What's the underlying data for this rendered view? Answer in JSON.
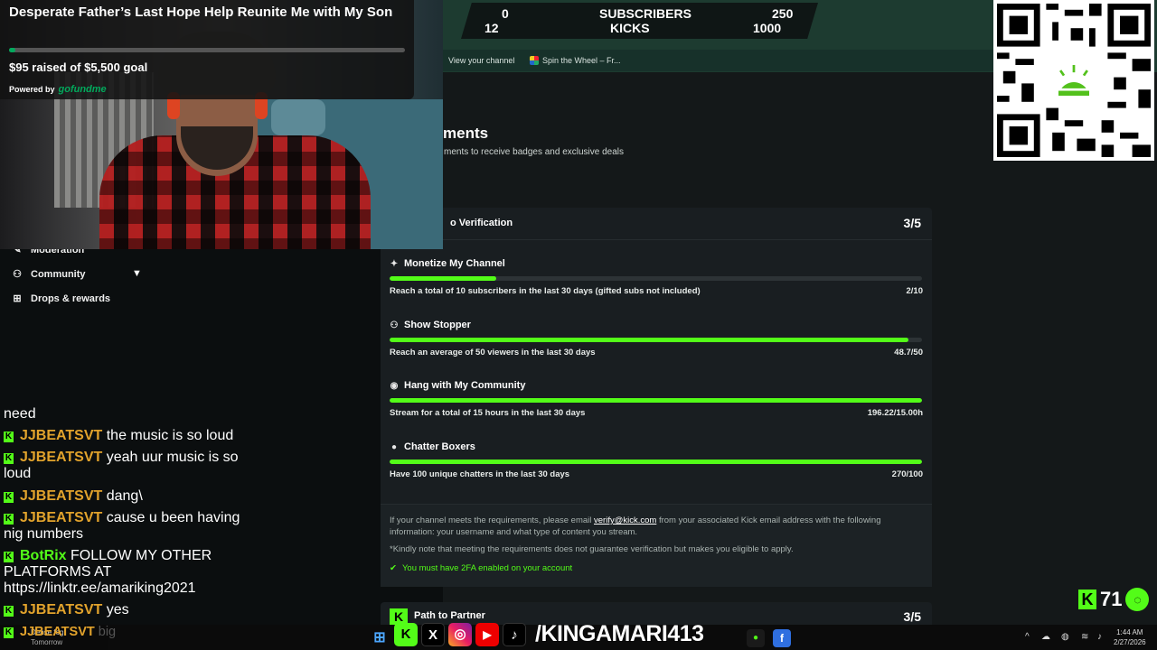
{
  "stats": {
    "sub_current": "0",
    "sub_label": "SUBSCRIBERS",
    "sub_goal": "250",
    "kick_current": "12",
    "kick_label": "KICKS",
    "kick_goal": "1000"
  },
  "bookmarks": [
    {
      "label": "View your channel"
    },
    {
      "label": "Spin the Wheel – Fr..."
    }
  ],
  "achievements": {
    "title": "ments",
    "subtitle": "ments to receive badges and exclusive deals"
  },
  "verification": {
    "title": "o Verification",
    "count": "3/5",
    "requirements": [
      {
        "icon": "sparkle-icon",
        "name": "Monetize My Channel",
        "desc": "Reach a total of 10 subscribers in the last 30 days (gifted subs not included)",
        "value": "2/10",
        "progress": 0.2
      },
      {
        "icon": "users-icon",
        "name": "Show Stopper",
        "desc": "Reach an average of 50 viewers in the last 30 days",
        "value": "48.7/50",
        "progress": 0.974
      },
      {
        "icon": "broadcast-icon",
        "name": "Hang with My Community",
        "desc": "Stream for a total of 15 hours in the last 30 days",
        "value": "196.22/15.00h",
        "progress": 1
      },
      {
        "icon": "chat-icon",
        "name": "Chatter Boxers",
        "desc": "Have 100 unique chatters in the last 30 days",
        "value": "270/100",
        "progress": 1
      }
    ],
    "note_prefix": "If your channel meets the requirements, please email ",
    "note_email": "verify@kick.com",
    "note_suffix": " from your associated Kick email address with the following information: your username and what type of content you stream.",
    "note2": "*Kindly note that meeting the requirements does not guarantee verification but makes you eligible to apply.",
    "twofa": "You must have 2FA enabled on your account"
  },
  "partner": {
    "title": "Path to Partner",
    "count": "3/5"
  },
  "nav": {
    "moderation": "Moderation",
    "community": "Community",
    "drops": "Drops & rewards"
  },
  "fundraiser": {
    "title": "Desperate Father’s Last Hope Help Reunite Me with My Son",
    "raised": "$95 raised of $5,500 goal",
    "progress": 0.017,
    "powered_by": "Powered by",
    "brand": "gofundme"
  },
  "chat": {
    "messages": [
      {
        "user": "",
        "text": "need"
      },
      {
        "user": "JJBEATSVT",
        "text": "the music is so loud"
      },
      {
        "user": "JJBEATSVT",
        "text": "yeah uur music is so loud"
      },
      {
        "user": "JJBEATSVT",
        "text": "dang\\"
      },
      {
        "user": "JJBEATSVT",
        "text": "cause u been having nig numbers"
      },
      {
        "user": "BotRix",
        "text": "FOLLOW MY OTHER PLATFORMS AT https://linktr.ee/amariking2021"
      },
      {
        "user": "JJBEATSVT",
        "text": "yes"
      },
      {
        "user": "JJBEATSVT",
        "text": "big"
      }
    ]
  },
  "weather": {
    "line1": "Dense fog",
    "line2": "Tomorrow"
  },
  "overlay": {
    "handle": "/KINGAMARI413",
    "kick_count": "71"
  },
  "taskbar": {
    "time": "1:44 AM",
    "date": "2/27/2026"
  },
  "colors": {
    "kick_green": "#53fc18",
    "username_orange": "#e2a32c",
    "gofundme_green": "#02a95c"
  }
}
